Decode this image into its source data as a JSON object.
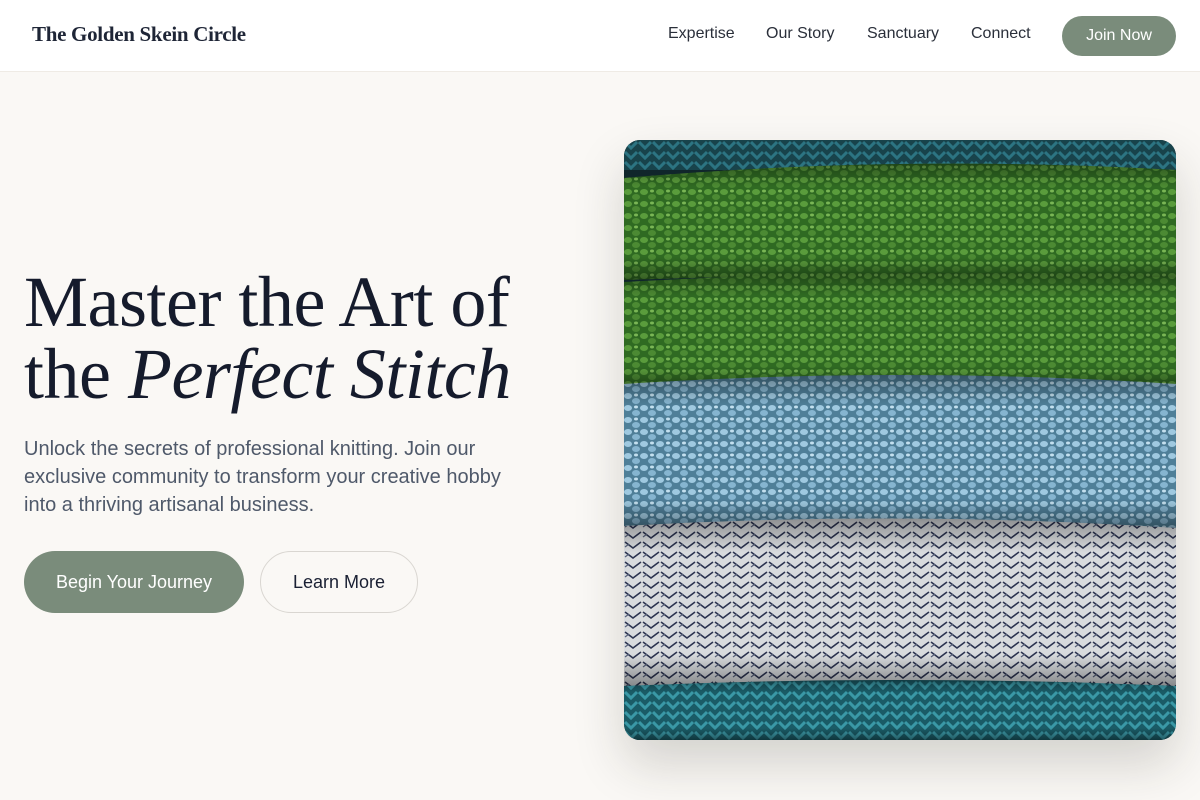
{
  "nav": {
    "brand": "The Golden Skein Circle",
    "links": [
      {
        "label": "Expertise"
      },
      {
        "label": "Our Story"
      },
      {
        "label": "Sanctuary"
      },
      {
        "label": "Connect"
      }
    ],
    "cta_label": "Join Now"
  },
  "hero": {
    "title_line1": "Master the Art of",
    "title_line2_plain": "the ",
    "title_line2_italic": "Perfect Stitch",
    "subtitle": "Unlock the secrets of professional knitting. Join our exclusive community to transform your creative hobby into a thriving artisanal business.",
    "primary_button": "Begin Your Journey",
    "secondary_button": "Learn More"
  },
  "image": {
    "subject": "stacked-knitted-sweaters",
    "layers": [
      {
        "color": "#1f5a63"
      },
      {
        "color": "#3f7f2c"
      },
      {
        "color": "#3f7f2c"
      },
      {
        "color": "#7fb1cf"
      },
      {
        "color": "#c9ccd0"
      },
      {
        "color": "#1f6f7c"
      }
    ]
  },
  "colors": {
    "accent": "#7a8c7b",
    "background": "#faf8f5",
    "heading": "#151b2c",
    "body_text": "#4f596a"
  }
}
